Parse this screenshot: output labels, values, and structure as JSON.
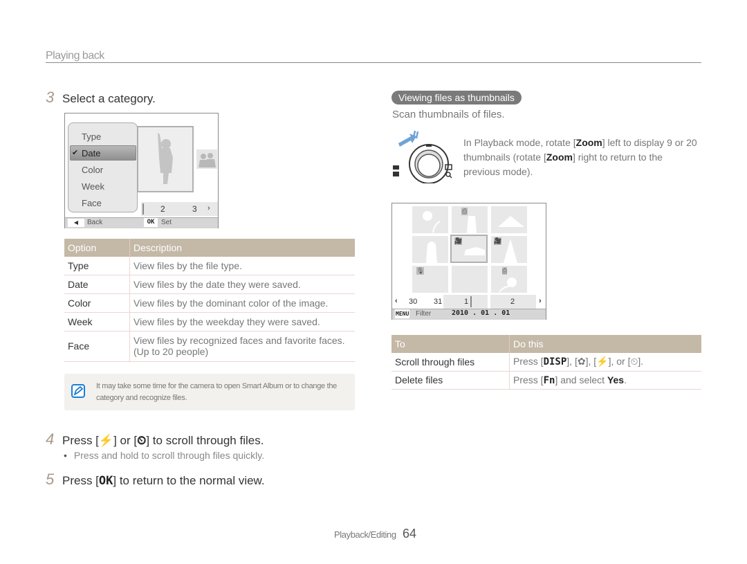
{
  "header": {
    "section_title": "Playing back"
  },
  "step3": {
    "number": "3",
    "text": "Select a category."
  },
  "camera_menu": {
    "items": [
      "Type",
      "Date",
      "Color",
      "Week",
      "Face"
    ],
    "selected": "Date",
    "check_icon": "checkmark-icon",
    "timeline": [
      "2",
      "3"
    ],
    "next_icon": "chevron-right-icon",
    "back_label": "Back",
    "ok_key": "OK",
    "set_label": "Set"
  },
  "option_table": {
    "headers": [
      "Option",
      "Description"
    ],
    "rows": [
      {
        "option": "Type",
        "description": "View files by the file type."
      },
      {
        "option": "Date",
        "description": "View files by the date they were saved."
      },
      {
        "option": "Color",
        "description": "View files by the dominant color of the image."
      },
      {
        "option": "Week",
        "description": "View files by the weekday they were saved."
      },
      {
        "option": "Face",
        "description": "View files by recognized faces and favorite faces.",
        "description2": "(Up to 20 people)"
      }
    ]
  },
  "note": {
    "icon": "note-pencil-icon",
    "text": "It may take some time for the camera to open Smart Album or to change the category and recognize files."
  },
  "step4": {
    "number": "4",
    "prefix": "Press [",
    "mid": "] or [",
    "suffix": "] to scroll through files.",
    "flash_icon": "flash-icon",
    "timer_icon": "timer-icon",
    "bullet": "Press and hold to scroll through files quickly."
  },
  "step5": {
    "number": "5",
    "prefix": "Press [",
    "key": "OK",
    "suffix": "] to return to the normal view."
  },
  "thumbnails_section": {
    "pill": "Viewing files as thumbnails",
    "intro": "Scan thumbnails of files.",
    "instruction_1": "In Playback mode, rotate [",
    "zoom_key": "Zoom",
    "instruction_2": "] left to display 9 or 20 thumbnails (rotate [",
    "instruction_3": "] right to return to the previous mode)."
  },
  "thumb_screen": {
    "timeline": [
      "30",
      "31",
      "1",
      "2"
    ],
    "prev_icon": "chevron-left-icon",
    "next_icon": "chevron-right-icon",
    "menu_key": "MENU",
    "filter_label": "Filter",
    "date": "2010 . 01 . 01"
  },
  "action_table": {
    "headers": [
      "To",
      "Do this"
    ],
    "rows": [
      {
        "to": "Scroll through files",
        "do_prefix": "Press [",
        "do_key": "DISP",
        "do_suffix": "], [✿], [⚡], or [⏲]."
      },
      {
        "to": "Delete files",
        "do_prefix": "Press [",
        "do_key": "Fn",
        "do_mid": "] and select ",
        "do_bold": "Yes",
        "do_end": "."
      }
    ]
  },
  "footer": {
    "section": "Playback/Editing",
    "page": "64"
  },
  "colors": {
    "table_header": "#c4b8a6",
    "note_bg": "#f3f1ed",
    "note_icon": "#1a7fd4",
    "step_number": "#a89a88",
    "pill_bg": "#7a7a7a"
  }
}
